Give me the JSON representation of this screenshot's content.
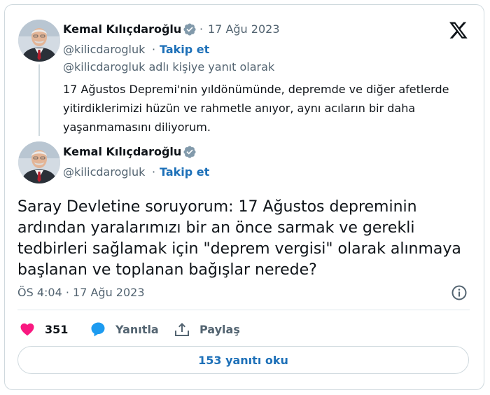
{
  "quoted_tweet": {
    "author_name": "Kemal Kılıçdaroğlu",
    "separator": "·",
    "date": "17 Ağu 2023",
    "handle": "@kilicdarogluk",
    "follow_label": "Takip et",
    "reply_to": "@kilicdarogluk adlı kişiye yanıt olarak",
    "text": "17 Ağustos Depremi'nin yıldönümünde, depremde ve diğer afetlerde yitirdiklerimizi hüzün ve rahmetle anıyor, aynı acıların bir daha yaşanmamasını diliyorum."
  },
  "main_tweet": {
    "author_name": "Kemal Kılıçdaroğlu",
    "handle": "@kilicdarogluk",
    "separator": "·",
    "follow_label": "Takip et",
    "text": "Saray Devletine soruyorum: 17 Ağustos depreminin ardından yaralarımızı bir an önce sarmak ve gerekli tedbirleri sağlamak için \"deprem vergisi\" olarak alınmaya başlanan ve toplanan bağışlar nerede?",
    "timestamp": "ÖS 4:04 · 17 Ağu 2023"
  },
  "actions": {
    "like_count": "351",
    "reply_label": "Yanıtla",
    "share_label": "Paylaş"
  },
  "read_replies_label": "153 yanıtı oku",
  "colors": {
    "accent_blue": "#1d9bf0",
    "link_blue": "#1d70b8",
    "like_pink": "#f91880",
    "muted": "#536471",
    "text": "#0f1419",
    "border": "#cfd9de"
  },
  "icons": [
    "x-logo-icon",
    "verified-badge-icon",
    "heart-icon",
    "reply-bubble-icon",
    "share-icon",
    "info-icon"
  ]
}
